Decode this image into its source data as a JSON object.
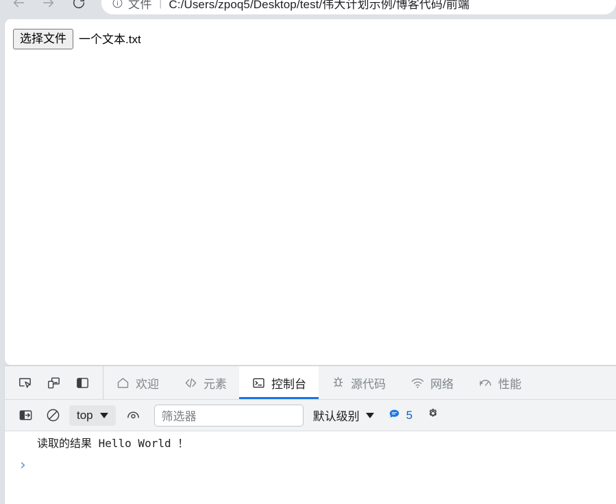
{
  "browser": {
    "nav": {
      "back_label": "Back",
      "forward_label": "Forward",
      "reload_label": "Reload"
    },
    "omnibox": {
      "info_icon": "info-circle-icon",
      "scheme_label": "文件",
      "separator": "|",
      "url": "C:/Users/zpoq5/Desktop/test/伟大计划示例/博客代码/前端"
    }
  },
  "page": {
    "file_input": {
      "button_label": "选择文件",
      "file_name": "一个文本.txt"
    }
  },
  "devtools": {
    "tools": [
      {
        "name": "inspect-element",
        "icon": "cursor-select-icon"
      },
      {
        "name": "device-toolbar",
        "icon": "device-toggle-icon"
      },
      {
        "name": "dock-side",
        "icon": "dock-panel-icon"
      }
    ],
    "tabs": [
      {
        "label": "欢迎",
        "icon": "home-icon",
        "active": false
      },
      {
        "label": "元素",
        "icon": "code-brackets-icon",
        "active": false
      },
      {
        "label": "控制台",
        "icon": "console-terminal-icon",
        "active": true
      },
      {
        "label": "源代码",
        "icon": "bug-icon",
        "active": false
      },
      {
        "label": "网络",
        "icon": "wifi-icon",
        "active": false
      },
      {
        "label": "性能",
        "icon": "performance-gauge-icon",
        "active": false
      }
    ],
    "console_toolbar": {
      "sidebar_toggle_icon": "sidebar-toggle-icon",
      "clear_console_icon": "clear-console-icon",
      "context_selector": "top",
      "live_expression_icon": "eye-icon",
      "filter_placeholder": "筛选器",
      "filter_value": "",
      "level_selector": "默认级别",
      "message_icon": "speech-bubble-icon",
      "message_count": "5",
      "settings_icon": "gear-icon"
    },
    "console_output": {
      "messages": [
        {
          "text": "读取的结果 Hello World ！"
        }
      ],
      "prompt_symbol": "›"
    }
  },
  "colors": {
    "chrome_bg": "#dee1e6",
    "devtools_bg": "#f1f3f4",
    "active_tab_underline": "#1a73e8",
    "prompt_blue": "#5a9ad4",
    "badge_blue": "#1a73e8"
  }
}
